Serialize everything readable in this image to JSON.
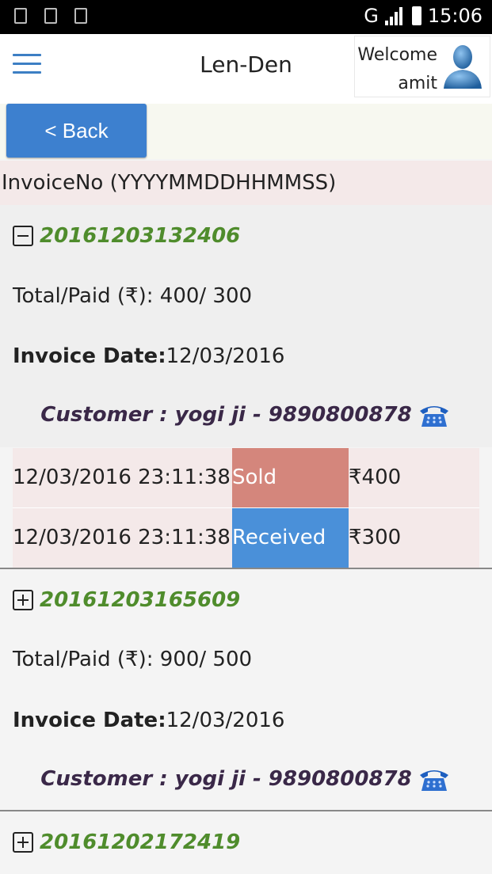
{
  "status_bar": {
    "network": "G",
    "time": "15:06",
    "left_icons": [
      "sim-icon",
      "image-icon",
      "message-icon"
    ]
  },
  "header": {
    "title": "Len-Den",
    "welcome_label": "Welcome",
    "user_name": "amit",
    "menu_icon": "hamburger-menu-icon",
    "avatar_icon": "user-avatar-icon"
  },
  "back_button": {
    "label": "< Back"
  },
  "invoice_header": "InvoiceNo (YYYYMMDDHHMMSS)",
  "invoices": [
    {
      "number": "20161203132406",
      "expanded": true,
      "total_paid_label": "Total/Paid (₹): 400/ 300",
      "date_label": "Invoice Date:",
      "date_value": "12/03/2016",
      "customer": "Customer : yogi ji - 9890800878",
      "transactions": [
        {
          "datetime": "12/03/2016 23:11:38",
          "type": "Sold",
          "type_color": "#d4867c",
          "amount": "₹400"
        },
        {
          "datetime": "12/03/2016 23:11:38",
          "type": "Received",
          "type_color": "#4a90d9",
          "amount": "₹300"
        }
      ]
    },
    {
      "number": "20161203165609",
      "expanded": false,
      "total_paid_label": "Total/Paid (₹): 900/ 500",
      "date_label": "Invoice Date:",
      "date_value": "12/03/2016",
      "customer": "Customer : yogi ji - 9890800878"
    },
    {
      "number": "20161202172419",
      "expanded": false
    }
  ],
  "colors": {
    "accent": "#3d80cf",
    "invoice_number": "#4f8c2c",
    "customer_text": "#3a2848"
  }
}
